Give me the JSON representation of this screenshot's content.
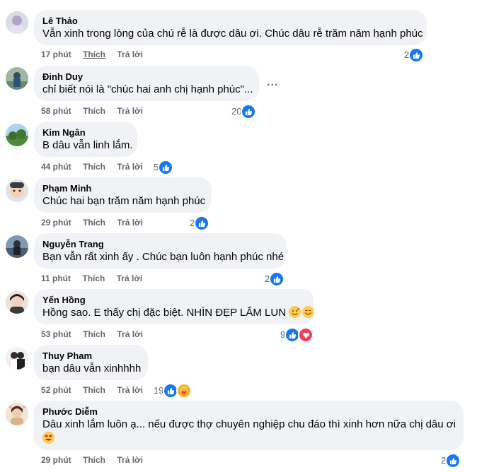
{
  "actions": {
    "like": "Thích",
    "reply": "Trả lời"
  },
  "more": "...",
  "comments": [
    {
      "name": "Lê Thảo",
      "lines": [
        "Vẫn xinh trong lòng của chú rễ là được dâu ơi. Chúc dâu rễ trăm năm hạnh phúc"
      ],
      "time": "17 phút",
      "reactions": "2",
      "liked": true
    },
    {
      "name": "Đinh Duy",
      "lines": [
        "chỉ biết nói là \"chúc hai anh chị hạnh phúc\"..."
      ],
      "time": "58 phút",
      "reactions": "20"
    },
    {
      "name": "Kim Ngân",
      "lines": [
        "B dâu vẫn linh lắm."
      ],
      "time": "44 phút",
      "reactions": "5"
    },
    {
      "name": "Phạm Minh",
      "lines": [
        "Chúc hai bạn trăm năm hạnh phúc"
      ],
      "time": "29 phút",
      "reactions": "2"
    },
    {
      "name": "Nguyễn Trang",
      "lines": [
        "Bạn vẫn rất xinh ấy . Chúc bạn luôn hạnh phúc nhé"
      ],
      "time": "11 phút",
      "reactions": "2"
    },
    {
      "name": "Yến Hồng",
      "lines": [
        "Hồng sao. E thấy chị đặc biệt. NHÌN ĐẸP LẮM LUN"
      ],
      "time": "53 phút",
      "reactions": "9"
    },
    {
      "name": "Thuy Pham",
      "lines": [
        "bạn dâu vẫn xinhhhh"
      ],
      "time": "52 phút",
      "reactions": "19"
    },
    {
      "name": "Phước Diễm",
      "lines": [
        "Dâu xinh lắm luôn ạ... nếu được thợ chuyên nghiệp chu đáo thì xinh hơn nữa chị dâu ơi"
      ],
      "time": "29 phút",
      "reactions": "2"
    }
  ]
}
